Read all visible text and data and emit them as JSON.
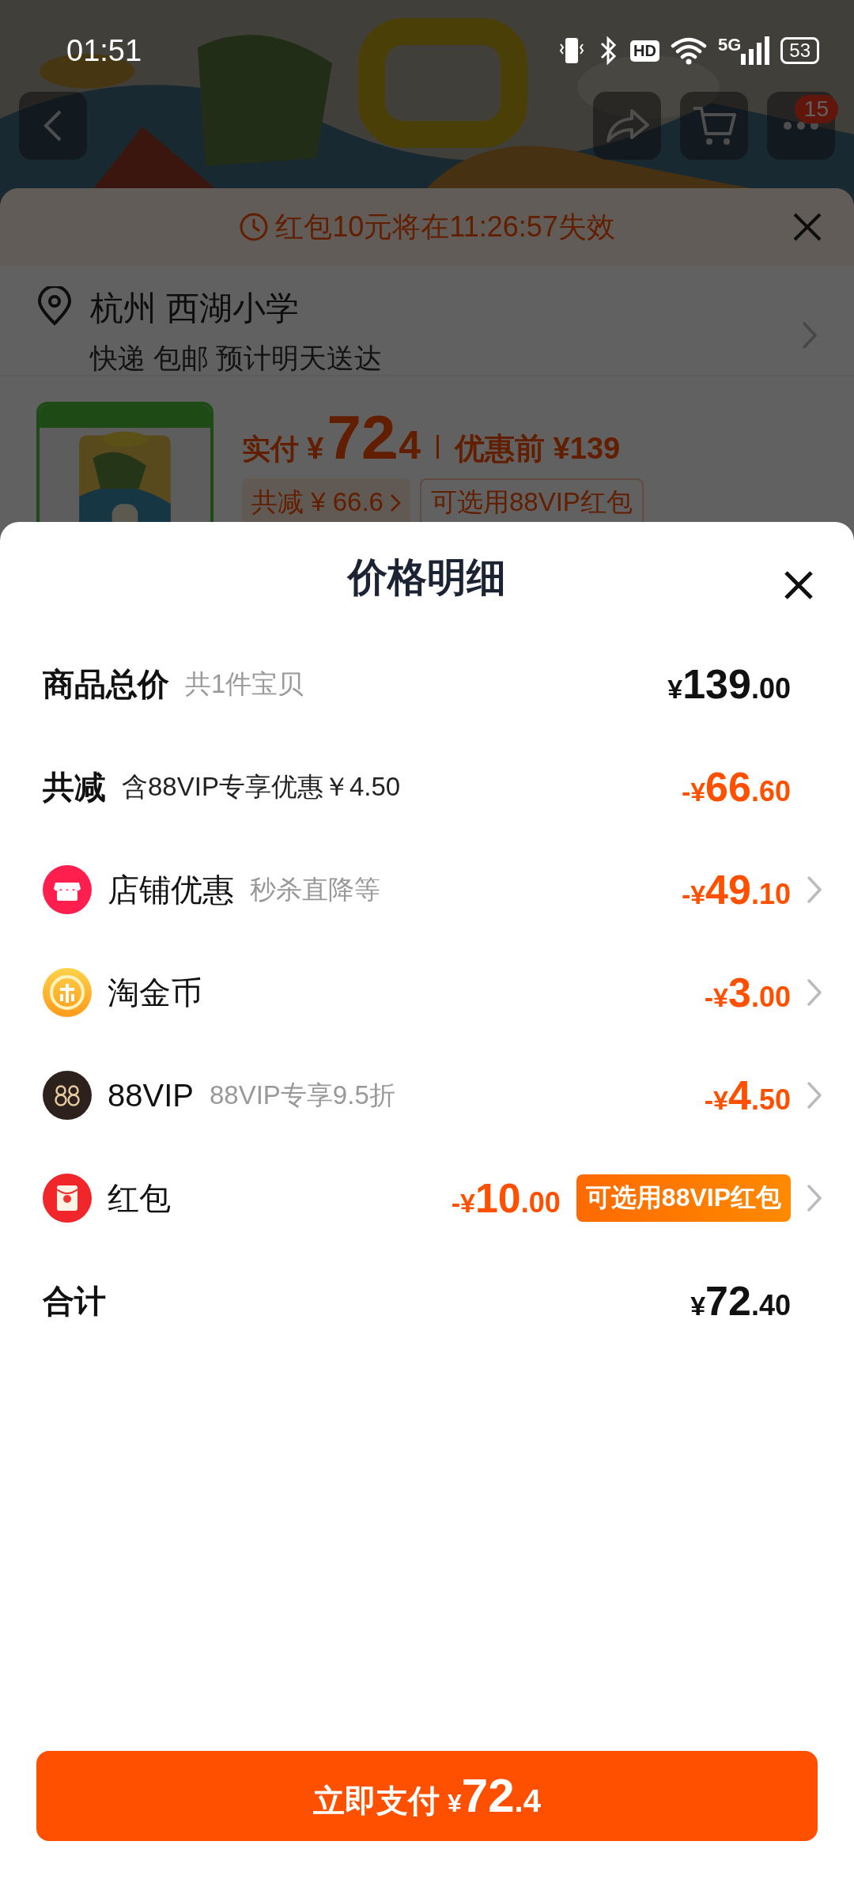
{
  "status_bar": {
    "time": "01:51",
    "hd": "HD",
    "network": "5G",
    "battery": "53"
  },
  "nav": {
    "badge": "15"
  },
  "countdown_banner": {
    "text": "红包10元将在11:26:57失效"
  },
  "address": {
    "place": "杭州 西湖小学",
    "delivery": "快递 包邮 预计明天送达"
  },
  "product": {
    "paid_label": "实付",
    "currency": "¥",
    "price_whole": "72",
    "price_decimal": ".4",
    "original_price": "优惠前 ¥139",
    "tags": [
      {
        "kind": "discount",
        "text": "共减 ¥ 66.6"
      },
      {
        "kind": "outline",
        "text": "可选用88VIP红包"
      }
    ]
  },
  "price_detail": {
    "title": "价格明细",
    "rows": [
      {
        "kind": "plain",
        "label": "商品总价",
        "note": "共1件宝贝",
        "note_dark": false,
        "amount": {
          "prefix": "¥",
          "whole": "139",
          "cents": ".00"
        },
        "emphasis": false
      },
      {
        "kind": "plain",
        "label": "共减",
        "note": "含88VIP专享优惠￥4.50",
        "note_dark": true,
        "amount": {
          "prefix": "-¥",
          "whole": "66",
          "cents": ".60"
        },
        "emphasis": true
      },
      {
        "kind": "store",
        "label": "店铺优惠",
        "note": "秒杀直降等",
        "note_dark": false,
        "amount": {
          "prefix": "-¥",
          "whole": "49",
          "cents": ".10"
        },
        "emphasis": true
      },
      {
        "kind": "coin",
        "label": "淘金币",
        "amount": {
          "prefix": "-¥",
          "whole": "3",
          "cents": ".00"
        },
        "emphasis": true
      },
      {
        "kind": "vip",
        "label": "88VIP",
        "note": "88VIP专享9.5折",
        "note_dark": false,
        "amount": {
          "prefix": "-¥",
          "whole": "4",
          "cents": ".50"
        },
        "emphasis": true
      },
      {
        "kind": "packet",
        "label": "红包",
        "amount": {
          "prefix": "-¥",
          "whole": "10",
          "cents": ".00"
        },
        "emphasis": true,
        "badge": "可选用88VIP红包"
      },
      {
        "kind": "plain",
        "label": "合计",
        "amount": {
          "prefix": "¥",
          "whole": "72",
          "cents": ".40"
        },
        "emphasis": false
      }
    ]
  },
  "pay_button": {
    "label": "立即支付",
    "currency": "¥",
    "whole": "72",
    "decimal": ".4"
  }
}
